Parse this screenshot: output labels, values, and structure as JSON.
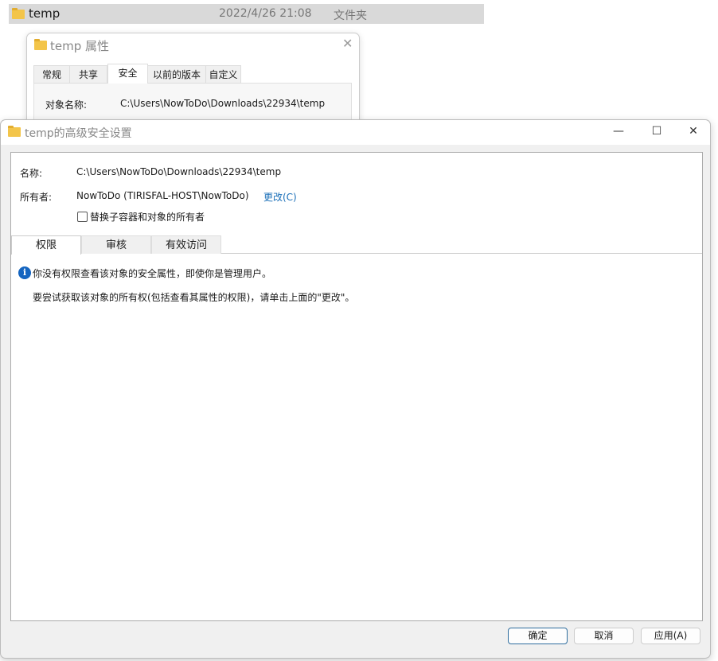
{
  "explorer_row": {
    "name": "temp",
    "date": "2022/4/26 21:08",
    "type": "文件夹"
  },
  "properties": {
    "title": "temp 属性",
    "tabs": [
      "常规",
      "共享",
      "安全",
      "以前的版本",
      "自定义"
    ],
    "object_label": "对象名称:",
    "object_value": "C:\\Users\\NowToDo\\Downloads\\22934\\temp"
  },
  "advanced": {
    "title": "temp的高级安全设置",
    "name_label": "名称:",
    "name_value": "C:\\Users\\NowToDo\\Downloads\\22934\\temp",
    "owner_label": "所有者:",
    "owner_value": "NowToDo (TIRISFAL-HOST\\NowToDo)",
    "change_link": "更改(C)",
    "replace_owner_checkbox": "替换子容器和对象的所有者",
    "tabs": [
      "权限",
      "审核",
      "有效访问"
    ],
    "info_message": "你没有权限查看该对象的安全属性，即使你是管理用户。",
    "hint_message": "要尝试获取该对象的所有权(包括查看其属性的权限)，请单击上面的\"更改\"。",
    "buttons": {
      "ok": "确定",
      "cancel": "取消",
      "apply": "应用(A)"
    }
  },
  "colors": {
    "link": "#1a6fb8",
    "info": "#1565c0"
  }
}
